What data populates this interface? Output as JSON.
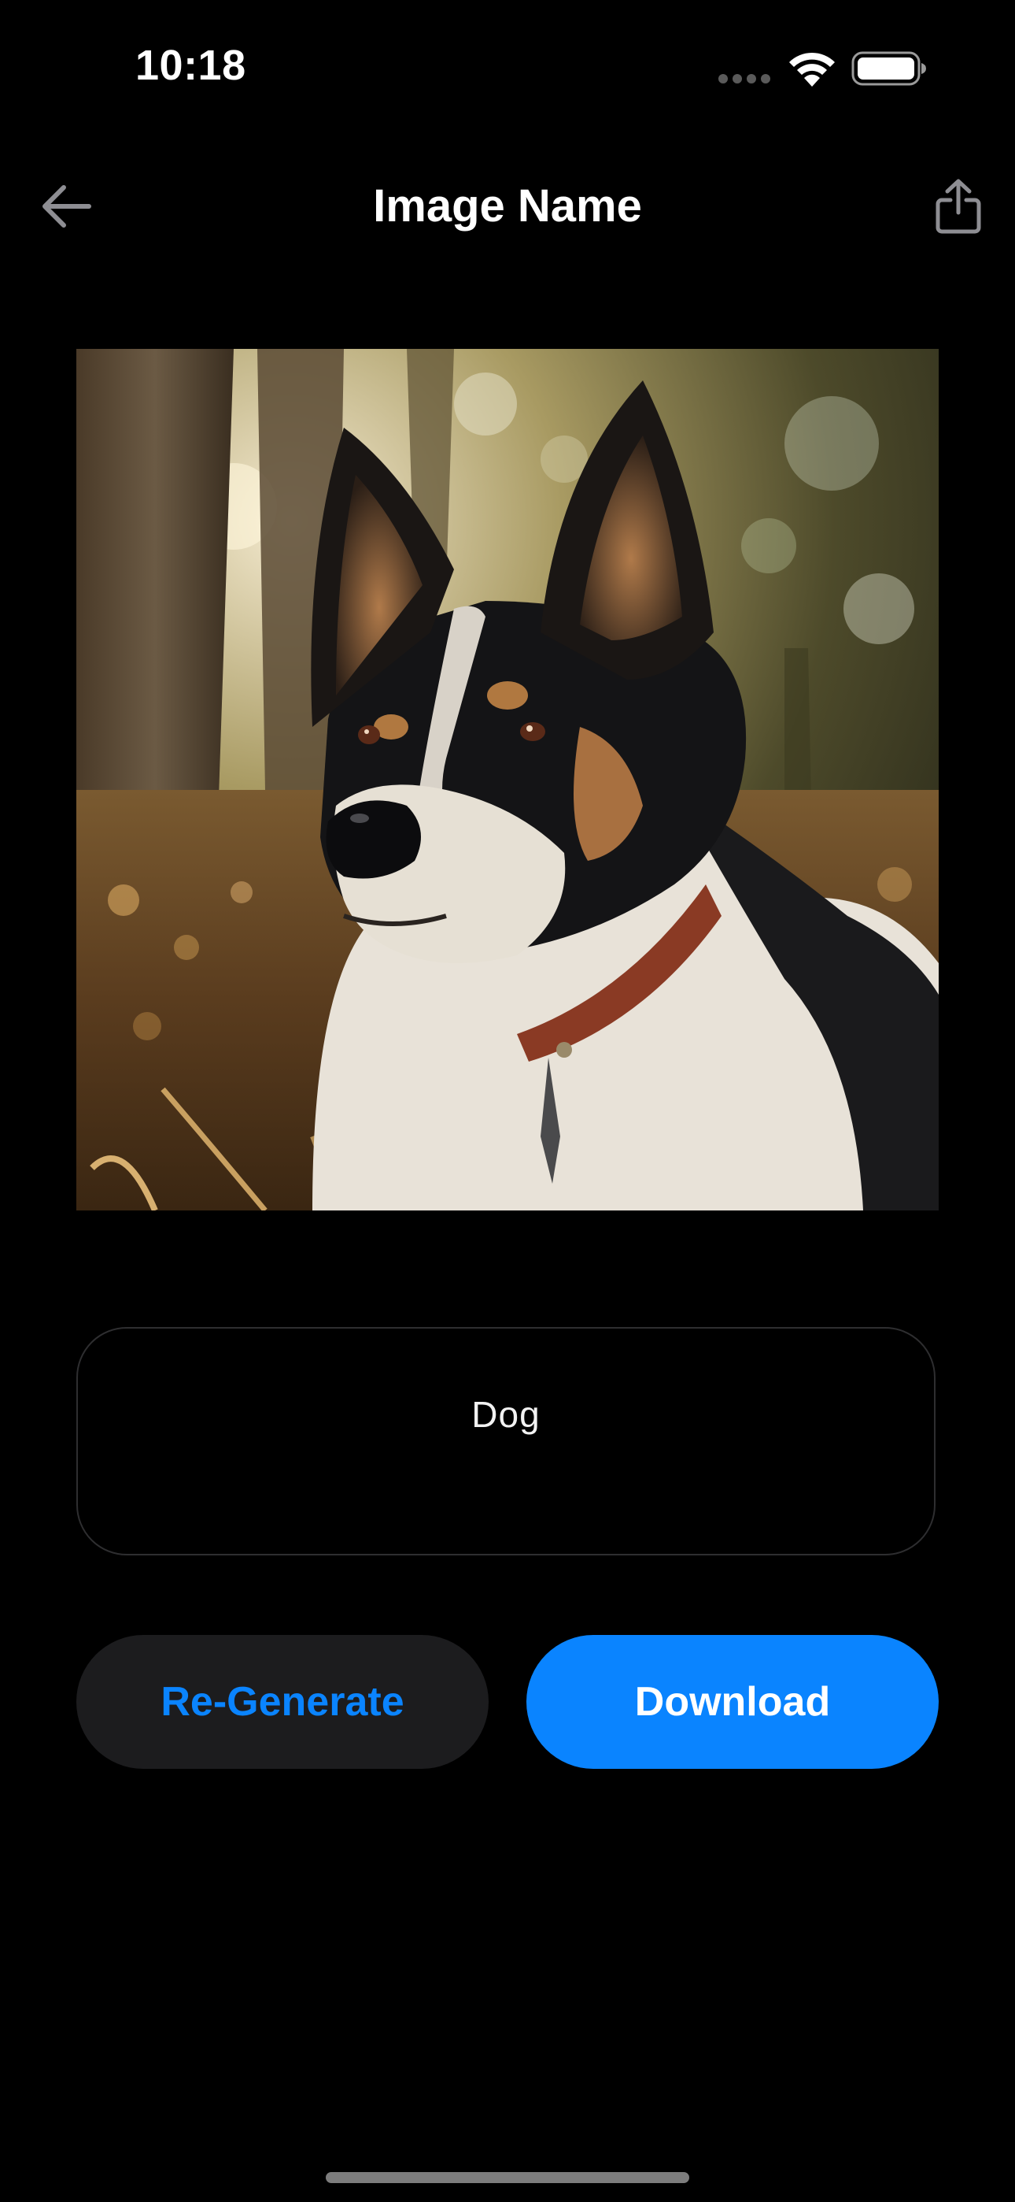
{
  "status_bar": {
    "time": "10:18"
  },
  "nav": {
    "title": "Image Name",
    "back_icon": "arrow-left-icon",
    "share_icon": "share-icon"
  },
  "image": {
    "subject": "dog-photo"
  },
  "prompt": {
    "value": "Dog"
  },
  "actions": {
    "regenerate_label": "Re-Generate",
    "download_label": "Download"
  },
  "colors": {
    "background": "#000000",
    "accent": "#0a84ff",
    "secondary_button": "#1c1c1e",
    "field_border": "#2e2e30"
  }
}
